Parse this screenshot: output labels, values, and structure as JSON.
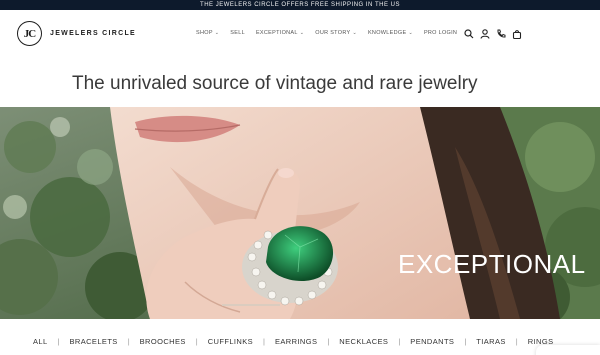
{
  "announcement": "THE JEWELERS CIRCLE OFFERS FREE SHIPPING IN THE US",
  "brand": {
    "mark": "JC",
    "name": "JEWELERS CIRCLE"
  },
  "nav": [
    {
      "label": "SHOP",
      "dropdown": true
    },
    {
      "label": "SELL",
      "dropdown": false
    },
    {
      "label": "EXCEPTIONAL",
      "dropdown": true
    },
    {
      "label": "OUR STORY",
      "dropdown": true
    },
    {
      "label": "KNOWLEDGE",
      "dropdown": true
    },
    {
      "label": "PRO LOGIN",
      "dropdown": false
    }
  ],
  "header_icons": [
    "search-icon",
    "account-icon",
    "phone-icon",
    "bag-icon"
  ],
  "tagline": "The unrivaled source of vintage and rare jewelry",
  "hero": {
    "title": "EXCEPTIONAL",
    "accent_color": "#1f7a43"
  },
  "categories": [
    "ALL",
    "BRACELETS",
    "BROOCHES",
    "CUFFLINKS",
    "EARRINGS",
    "NECKLACES",
    "PENDANTS",
    "TIARAS",
    "RINGS"
  ],
  "colors": {
    "announcement_bg": "#0d1a2c",
    "text": "#2a2a2a"
  }
}
